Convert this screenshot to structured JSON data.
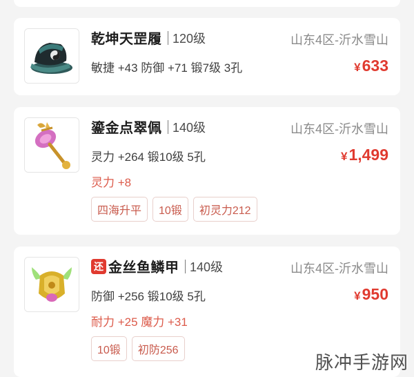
{
  "listings": [
    {
      "name": "乾坤天罡履",
      "level": "120级",
      "server": "山东4区-沂水雪山",
      "stats": "敏捷 +43 防御 +71 锻7级 3孔",
      "currency": "¥",
      "price": "633",
      "icon": "black-boots-icon"
    },
    {
      "name": "鎏金点翠佩",
      "level": "140级",
      "server": "山东4区-沂水雪山",
      "stats": "灵力 +264 锻10级 5孔",
      "extra": "灵力 +8",
      "currency": "¥",
      "price": "1,499",
      "tags": [
        "四海升平",
        "10锻",
        "初灵力212"
      ],
      "icon": "gold-pendant-icon"
    },
    {
      "badge": "还",
      "name": "金丝鱼鳞甲",
      "level": "140级",
      "server": "山东4区-沂水雪山",
      "stats": "防御 +256 锻10级 5孔",
      "extra": "耐力 +25 魔力 +31",
      "currency": "¥",
      "price": "950",
      "tags": [
        "10锻",
        "初防256"
      ],
      "icon": "gold-armor-icon"
    }
  ],
  "watermark": "脉冲手游网",
  "colors": {
    "price": "#e03a2f",
    "badge": "#e03a2f",
    "tag_text": "#c85a4c"
  }
}
